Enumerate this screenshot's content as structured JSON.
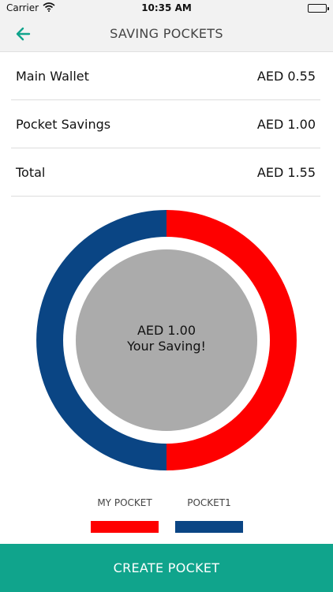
{
  "status_bar": {
    "carrier": "Carrier",
    "time": "10:35 AM"
  },
  "nav": {
    "title": "SAVING POCKETS",
    "back_icon": "arrow-left-icon"
  },
  "summary": [
    {
      "label": "Main Wallet",
      "value": "AED 0.55"
    },
    {
      "label": "Pocket Savings",
      "value": "AED 1.00"
    },
    {
      "label": "Total",
      "value": "AED 1.55"
    }
  ],
  "chart_data": {
    "type": "pie",
    "center_amount": "AED 1.00",
    "center_caption": "Your Saving!",
    "series": [
      {
        "name": "MY POCKET",
        "value": 0.5,
        "color": "#fe0000"
      },
      {
        "name": "POCKET1",
        "value": 0.5,
        "color": "#0a4584"
      }
    ]
  },
  "legend": [
    {
      "label": "MY POCKET",
      "color": "#fe0000"
    },
    {
      "label": "POCKET1",
      "color": "#0a4584"
    }
  ],
  "colors": {
    "accent": "#10a48c",
    "center_fill": "#ababab"
  },
  "actions": {
    "create_label": "CREATE POCKET"
  }
}
